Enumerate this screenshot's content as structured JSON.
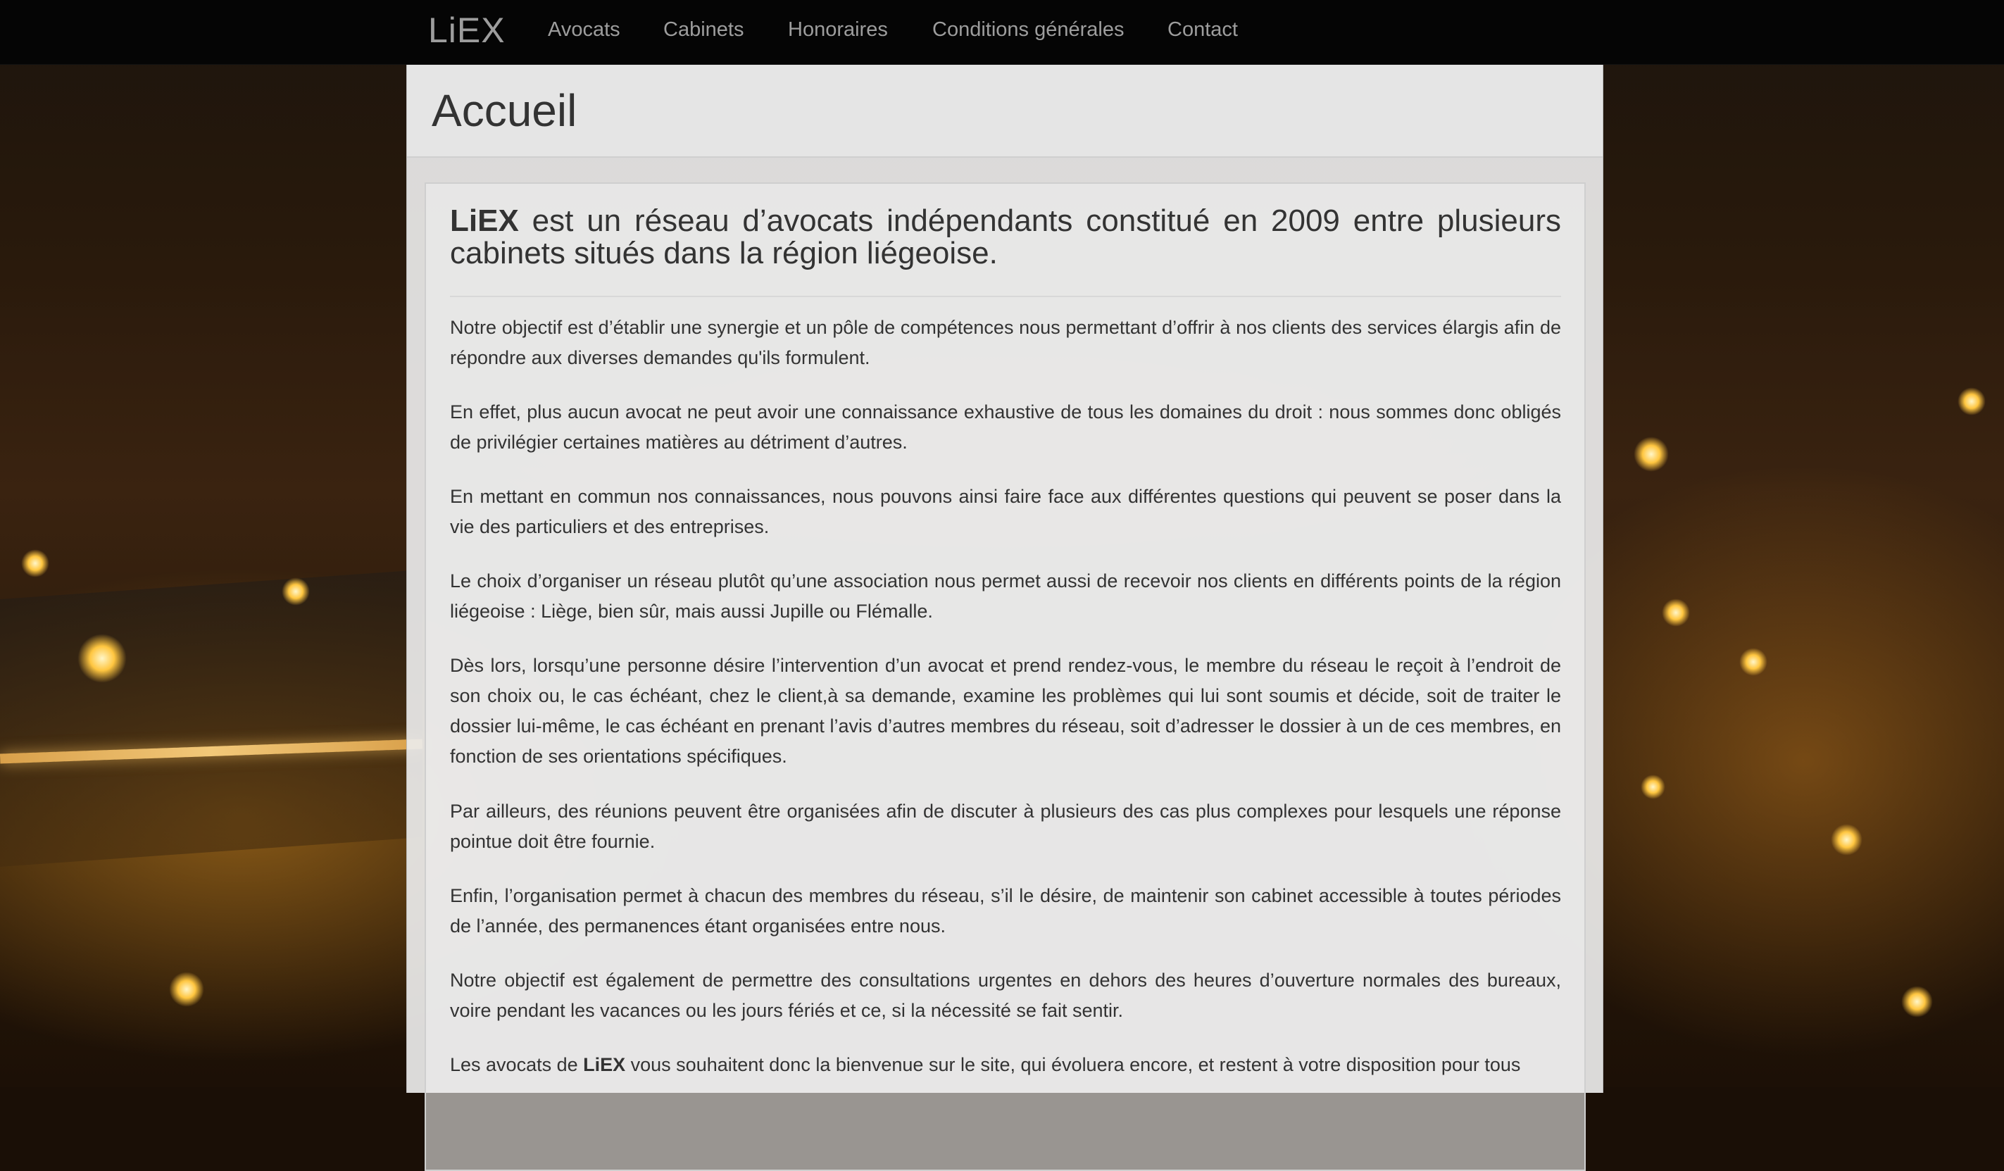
{
  "navbar": {
    "brand": "LiEX",
    "items": [
      {
        "label": "Avocats"
      },
      {
        "label": "Cabinets"
      },
      {
        "label": "Honoraires"
      },
      {
        "label": "Conditions générales"
      },
      {
        "label": "Contact"
      }
    ]
  },
  "page": {
    "title": "Accueil"
  },
  "intro": {
    "brand": "LiEX",
    "text": " est un réseau d’avocats indépendants constitué en 2009 entre plusieurs cabinets situés dans la région liégeoise."
  },
  "paragraphs": [
    "Notre objectif est d’établir une synergie et un pôle de compétences nous permettant d’offrir à nos clients des services élargis afin de répondre aux diverses demandes qu'ils formulent.",
    "En effet, plus aucun avocat ne peut avoir une connaissance exhaustive de tous les domaines du droit : nous sommes donc obligés de privilégier certaines matières au détriment d’autres.",
    "En mettant en commun nos connaissances, nous pouvons ainsi faire face aux différentes questions qui peuvent se poser dans la vie des particuliers et des entreprises.",
    "Le choix d’organiser un réseau plutôt qu’une association nous permet aussi de recevoir nos clients en différents points de la région liégeoise : Liège, bien sûr, mais aussi Jupille ou Flémalle.",
    "Dès lors, lorsqu’une personne désire l’intervention d’un avocat et prend rendez-vous, le membre du réseau le reçoit à l’endroit de son choix ou, le cas échéant, chez le client,à sa demande, examine les problèmes qui lui sont soumis et décide, soit de traiter le dossier lui-même, le cas échéant en prenant l’avis d’autres membres du réseau, soit d’adresser le dossier à un de ces membres, en fonction de ses orientations spécifiques.",
    "Par ailleurs, des réunions peuvent être organisées afin de discuter à plusieurs des cas plus complexes pour lesquels une réponse pointue doit être fournie.",
    "Enfin, l’organisation permet à chacun des membres du réseau, s’il le désire, de maintenir son cabinet accessible à toutes périodes de l’année, des permanences étant organisées entre nous.",
    "Notre objectif est également de permettre des consultations urgentes en dehors des heures d’ouverture normales des bureaux, voire pendant les vacances ou les jours fériés et ce, si la nécessité se fait sentir."
  ],
  "closing": {
    "before": "Les avocats de ",
    "brand": "LiEX",
    "after": " vous souhaitent donc la bienvenue sur le site, qui évoluera encore, et restent à votre disposition pour tous"
  }
}
